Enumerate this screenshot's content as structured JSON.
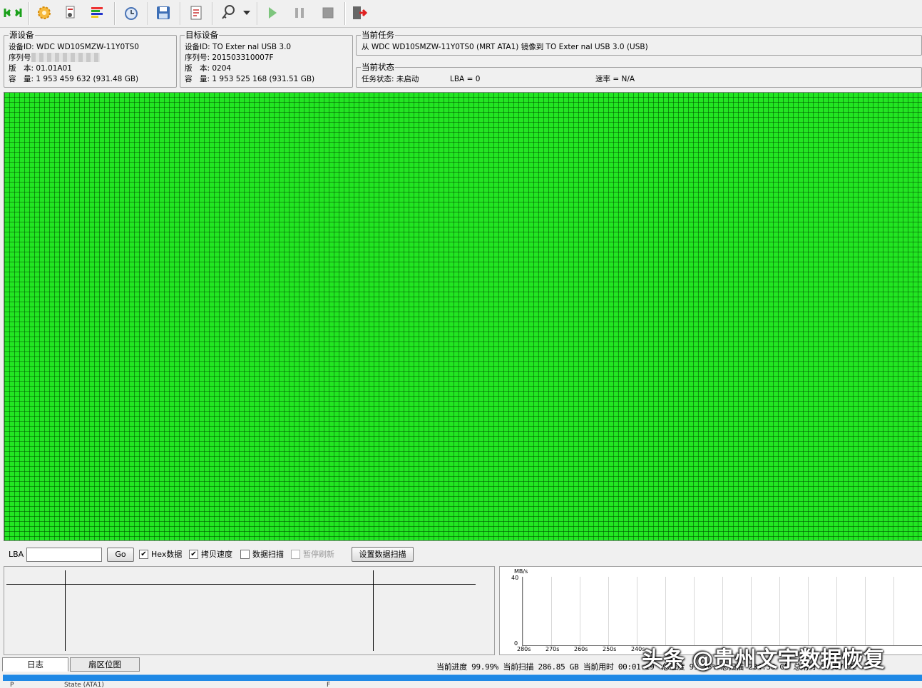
{
  "toolbar": {
    "buttons": [
      "connect-icon",
      "settings-icon",
      "device-icon",
      "color-bars-icon",
      "clock-icon",
      "save-icon",
      "report-icon",
      "key-icon",
      "play-icon",
      "pause-icon",
      "stop-icon",
      "exit-icon"
    ]
  },
  "source": {
    "title": "源设备",
    "device_id": "设备ID: WDC WD10SMZW-11Y0TS0",
    "serial_label": "序列号",
    "version": "版　本: 01.01A01",
    "capacity": "容　量: 1 953 459 632 (931.48 GB)"
  },
  "target": {
    "title": "目标设备",
    "device_id": "设备ID: TO Exter nal USB 3.0",
    "serial": "序列号: 201503310007F",
    "version": "版　本: 0204",
    "capacity": "容　量: 1 953 525 168 (931.51 GB)"
  },
  "task": {
    "title": "当前任务",
    "text": "从 WDC WD10SMZW-11Y0TS0 (MRT ATA1) 镜像到 TO Exter nal USB 3.0 (USB)"
  },
  "status": {
    "title": "当前状态",
    "task_state": "任务状态: 未启动",
    "lba": "LBA = 0",
    "speed": "速率 = N/A"
  },
  "controls": {
    "lba_label": "LBA",
    "lba_value": "",
    "go_label": "Go",
    "hex_label": "Hex数据",
    "hex_checked": true,
    "copy_speed_label": "拷贝速度",
    "copy_speed_checked": true,
    "data_scan_label": "数据扫描",
    "data_scan_checked": false,
    "pause_refresh_label": "暂停刷新",
    "pause_refresh_checked": false,
    "set_scan_label": "设置数据扫描"
  },
  "speed_chart": {
    "unit": "MB/s",
    "y_max": "40",
    "y_min": "0",
    "x_ticks": [
      "280s",
      "270s",
      "260s",
      "250s",
      "240s"
    ]
  },
  "tabs": [
    "日志",
    "扇区位图"
  ],
  "statusbar": {
    "text": "当前进度 99.99% 当前扫描 286.85 GB 当前用时 00:01:19　总进度 99.16% 总扫描 284.38 GB 总用时 00:07:22"
  },
  "watermark": "头条 @贵州文宇数据恢复",
  "bottom": {
    "c1": "P",
    "c2": "State (ATA1)",
    "c3": "F"
  },
  "colors": {
    "sector_ok": "#22e622",
    "progress": "#1e88e5"
  }
}
